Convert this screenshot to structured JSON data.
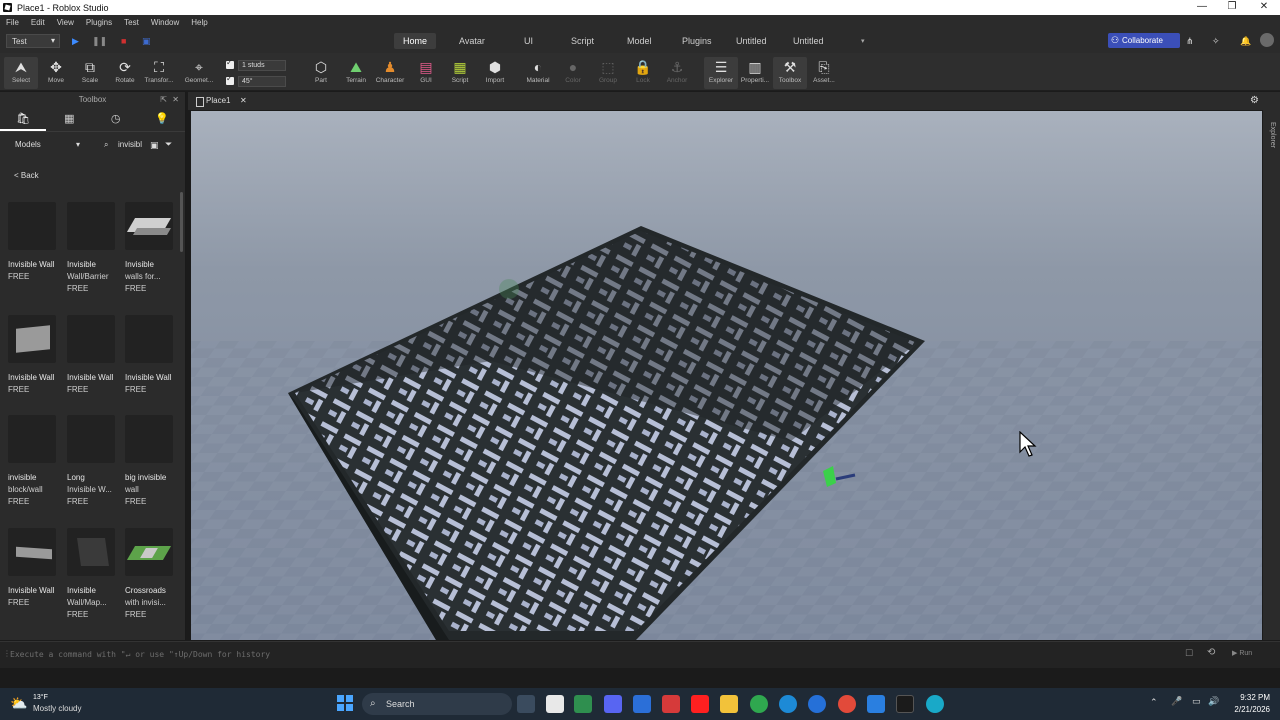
{
  "window": {
    "title": "Place1 - Roblox Studio",
    "minimize": "—",
    "maximize": "❐",
    "close": "✕"
  },
  "menu": [
    "File",
    "Edit",
    "View",
    "Plugins",
    "Test",
    "Window",
    "Help"
  ],
  "mode": {
    "value": "Test"
  },
  "ribbon_tabs": [
    "Home",
    "Avatar",
    "UI",
    "Script",
    "Model",
    "Plugins",
    "Untitled",
    "Untitled"
  ],
  "collaborate": "Collaborate",
  "tools": [
    {
      "label": "Select"
    },
    {
      "label": "Move"
    },
    {
      "label": "Scale"
    },
    {
      "label": "Rotate"
    },
    {
      "label": "Transfor..."
    },
    {
      "label": "Geomet..."
    },
    {
      "label": "Part"
    },
    {
      "label": "Terrain"
    },
    {
      "label": "Character"
    },
    {
      "label": "GUI"
    },
    {
      "label": "Script"
    },
    {
      "label": "Import"
    },
    {
      "label": "Material"
    },
    {
      "label": "Color"
    },
    {
      "label": "Group"
    },
    {
      "label": "Lock"
    },
    {
      "label": "Anchor"
    },
    {
      "label": "Explorer"
    },
    {
      "label": "Properti..."
    },
    {
      "label": "Toolbox"
    },
    {
      "label": "Asset..."
    }
  ],
  "snap": {
    "move": "1 studs",
    "rotate": "45°"
  },
  "toolbox": {
    "title": "Toolbox",
    "category": "Models",
    "search": "invisibl",
    "back": "< Back",
    "assets": [
      {
        "name1": "Invisible Wall",
        "name2": "",
        "price": "FREE"
      },
      {
        "name1": "Invisible",
        "name2": "Wall/Barrier",
        "price": "FREE"
      },
      {
        "name1": "Invisible",
        "name2": "walls for...",
        "price": "FREE"
      },
      {
        "name1": "Invisible Wall",
        "name2": "",
        "price": "FREE"
      },
      {
        "name1": "Invisible Wall",
        "name2": "",
        "price": "FREE"
      },
      {
        "name1": "Invisible Wall",
        "name2": "",
        "price": "FREE"
      },
      {
        "name1": "invisible",
        "name2": "block/wall",
        "price": "FREE"
      },
      {
        "name1": "Long",
        "name2": "Invisible W...",
        "price": "FREE"
      },
      {
        "name1": "big invisible",
        "name2": "wall",
        "price": "FREE"
      },
      {
        "name1": "Invisible Wall",
        "name2": "",
        "price": "FREE"
      },
      {
        "name1": "Invisible",
        "name2": "Wall/Map...",
        "price": "FREE"
      },
      {
        "name1": "Crossroads",
        "name2": "with invisi...",
        "price": "FREE"
      }
    ]
  },
  "document_tab": "Place1",
  "explorer_strip": "Explorer",
  "command_bar": {
    "placeholder": "Execute a command with \"↵ or use \"↑Up/Down for history",
    "run": "Run"
  },
  "taskbar": {
    "weather_temp": "13°F",
    "weather_desc": "Mostly cloudy",
    "search": "Search",
    "time": "9:32 PM",
    "date": "2/21/2026"
  }
}
